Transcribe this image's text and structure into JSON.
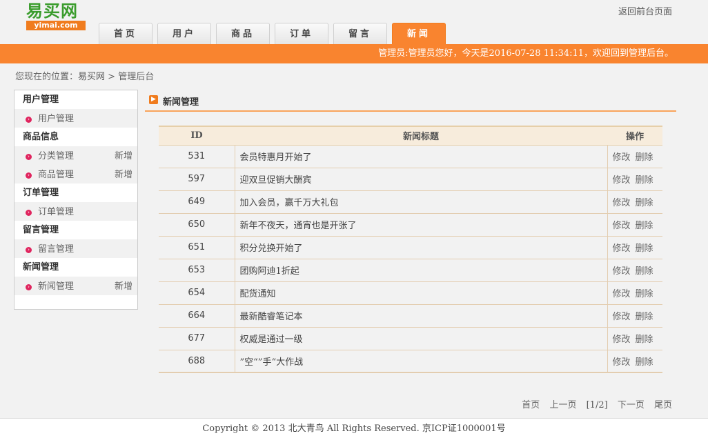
{
  "logo": {
    "main": "易买网",
    "sub": "yimai.com"
  },
  "header": {
    "back_link": "返回前台页面"
  },
  "nav": {
    "tabs": [
      "首页",
      "用户",
      "商品",
      "订单",
      "留言",
      "新闻"
    ],
    "active_index": 5
  },
  "welcome": "管理员:管理员您好，今天是2016-07-28 11:34:11，欢迎回到管理后台。",
  "breadcrumb": {
    "prefix": "您现在的位置：",
    "home": "易买网",
    "separator": ">",
    "current": "管理后台"
  },
  "sidebar": {
    "groups": [
      {
        "title": "用户管理",
        "items": [
          {
            "label": "用户管理",
            "add": ""
          }
        ]
      },
      {
        "title": "商品信息",
        "items": [
          {
            "label": "分类管理",
            "add": "新增"
          },
          {
            "label": "商品管理",
            "add": "新增"
          }
        ]
      },
      {
        "title": "订单管理",
        "items": [
          {
            "label": "订单管理",
            "add": ""
          }
        ]
      },
      {
        "title": "留言管理",
        "items": [
          {
            "label": "留言管理",
            "add": ""
          }
        ]
      },
      {
        "title": "新闻管理",
        "items": [
          {
            "label": "新闻管理",
            "add": "新增"
          }
        ]
      }
    ]
  },
  "main": {
    "title": "新闻管理",
    "columns": [
      "ID",
      "新闻标题",
      "操作"
    ],
    "actions": {
      "edit": "修改",
      "delete": "删除"
    },
    "rows": [
      {
        "id": "531",
        "title": "会员特惠月开始了"
      },
      {
        "id": "597",
        "title": "迎双旦促销大酬宾"
      },
      {
        "id": "649",
        "title": "加入会员，赢千万大礼包"
      },
      {
        "id": "650",
        "title": "新年不夜天，通宵也是开张了"
      },
      {
        "id": "651",
        "title": "积分兑换开始了"
      },
      {
        "id": "653",
        "title": "团购阿迪1折起"
      },
      {
        "id": "654",
        "title": "配货通知"
      },
      {
        "id": "664",
        "title": "最新酷睿笔记本"
      },
      {
        "id": "677",
        "title": "权威是通过一级"
      },
      {
        "id": "688",
        "title": "”空“”手“大作战"
      }
    ]
  },
  "pager": {
    "first": "首页",
    "prev": "上一页",
    "status": "[1/2]",
    "next": "下一页",
    "last": "尾页"
  },
  "footer": "Copyright © 2013 北大青鸟 All Rights Reserved. 京ICP证1000001号",
  "colors": {
    "accent": "#f9842f",
    "logo_green": "#3a9c2c",
    "bullet": "#e0245e"
  }
}
